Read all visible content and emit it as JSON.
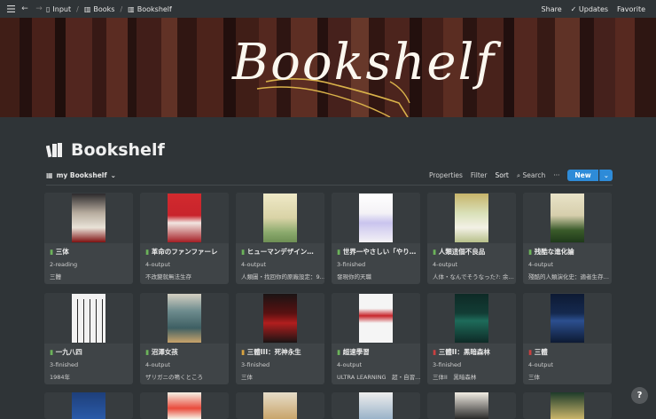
{
  "breadcrumb": {
    "items": [
      "Input",
      "Books",
      "Bookshelf"
    ]
  },
  "topbar_actions": {
    "share": "Share",
    "updates": "Updates",
    "favorite": "Favorite"
  },
  "cover": {
    "title": "Bookshelf"
  },
  "page": {
    "title": "Bookshelf"
  },
  "toolbar": {
    "view": "my Bookshelf",
    "properties": "Properties",
    "filter": "Filter",
    "sort": "Sort",
    "search": "Search",
    "more": "···",
    "new": "New"
  },
  "cards": [
    {
      "title": "三体",
      "status": "2-reading",
      "author": "三體",
      "cover_color": "#b8ad9f"
    },
    {
      "title": "革命のファンファーレ",
      "status": "4-output",
      "author": "不改變就無法生存",
      "cover_color": "#c8242c"
    },
    {
      "title": "ヒューマンデザイン…",
      "status": "4-output",
      "author": "人類圖・找回你的原廠設定：9…",
      "cover_color": "#d9d3a6"
    },
    {
      "title": "世界一やさしい「やり…",
      "status": "3-finished",
      "author": "發現你的天職",
      "cover_color": "#f4f2f6"
    },
    {
      "title": "人類這個不良品",
      "status": "4-output",
      "author": "人体・なんでそうなった?: 余…",
      "cover_color": "#d9e0b8"
    },
    {
      "title": "残酷な進化論",
      "status": "4-output",
      "author": "殘酷的人類演化史：適者生存…",
      "cover_color": "#e9e3c8"
    },
    {
      "title": "一九八四",
      "status": "3-finished",
      "author": "1984年",
      "cover_color": "#f2f2f2"
    },
    {
      "title": "沼澤女孩",
      "status": "4-output",
      "author": "ザリガニの鳴くところ",
      "cover_color": "#6e8c8e"
    },
    {
      "title": "三體III：死神永生",
      "status": "3-finished",
      "author": "三体",
      "cover_color": "#1b1414"
    },
    {
      "title": "超速學習",
      "status": "4-output",
      "author": "ULTRA LEARNING　超・自習…",
      "cover_color": "#f5f5f5"
    },
    {
      "title": "三體II：黑暗森林",
      "status": "3-finished",
      "author": "三体II　黒暗森林",
      "cover_color": "#0e2a26"
    },
    {
      "title": "三體",
      "status": "4-output",
      "author": "三体",
      "cover_color": "#0d1a33"
    }
  ],
  "help": "?"
}
